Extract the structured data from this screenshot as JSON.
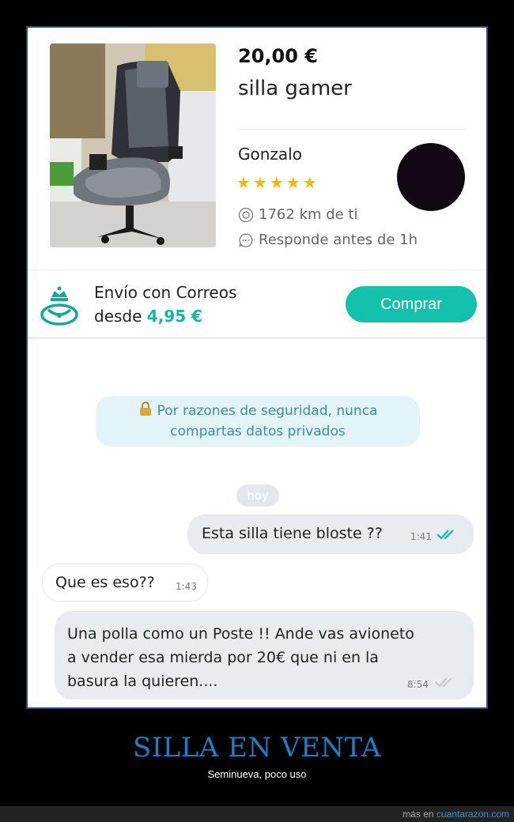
{
  "listing": {
    "price": "20,00 €",
    "title": "silla gamer",
    "seller_name": "Gonzalo",
    "rating_stars": 5,
    "stars_text": "★★★★★",
    "distance": "1762 km de ti",
    "response_time": "Responde antes de 1h"
  },
  "shipping": {
    "line1": "Envío con Correos",
    "desde_label": "desde",
    "amount": "4,95 €",
    "buy_label": "Comprar"
  },
  "chat": {
    "security_notice_line1": "Por razones de seguridad, nunca",
    "security_notice_line2": "compartas datos privados",
    "day_label": "hoy",
    "messages": [
      {
        "text": "Esta silla tiene bloste ??",
        "time": "1:41",
        "sender": "me",
        "status": "read"
      },
      {
        "text": "Que es eso??",
        "time": "1:43",
        "sender": "other"
      },
      {
        "lines": [
          "Una polla como un Poste  !! Ande vas avioneto",
          "a vender esa mierda por 20€ que ni en la",
          "basura la quieren...."
        ],
        "time": "8:54",
        "sender": "me",
        "status": "delivered"
      }
    ]
  },
  "caption": {
    "title": "SILLA EN VENTA",
    "subtitle": "Seminueva, poco uso"
  },
  "footer": {
    "prefix": "más en",
    "site": "cuantarazon.com"
  },
  "colors": {
    "accent": "#13c1ac",
    "star": "#f5b800",
    "caption_title": "#1e7fc7",
    "notice_bg": "#e2f4f7",
    "read_ticks": "#13b6a3"
  }
}
